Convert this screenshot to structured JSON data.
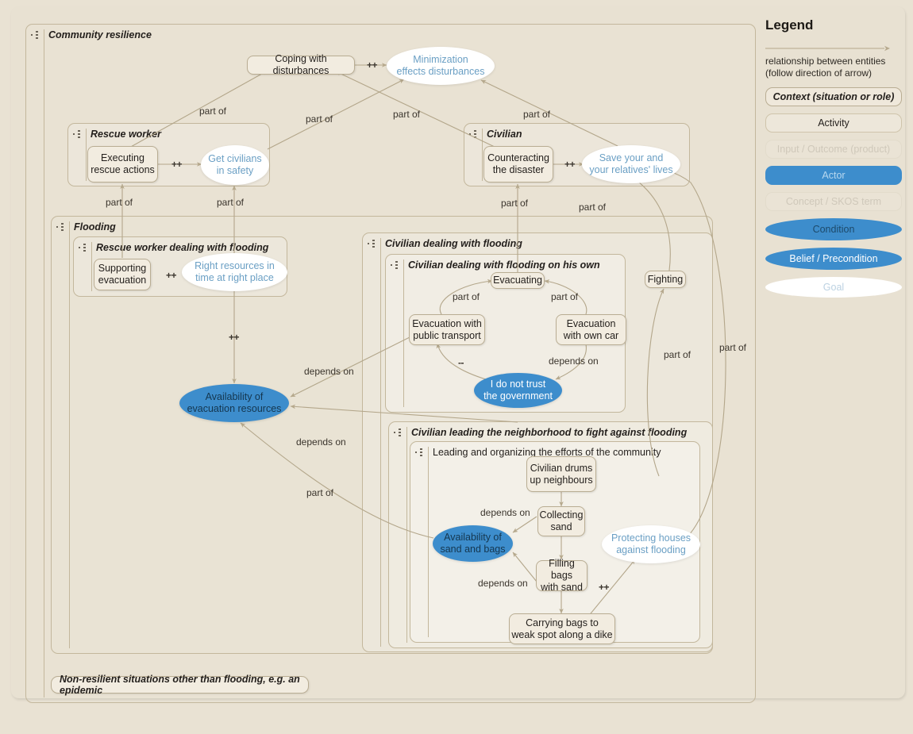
{
  "legend": {
    "title": "Legend",
    "arrow_note": "relationship between entities\n(follow direction of arrow)",
    "note_line1": "relationship between entities",
    "note_line2": "(follow direction of arrow)",
    "items": [
      {
        "key": "context",
        "label": "Context (situation or role)"
      },
      {
        "key": "activity",
        "label": "Activity"
      },
      {
        "key": "product",
        "label": "Input / Outcome (product)"
      },
      {
        "key": "actor",
        "label": "Actor"
      },
      {
        "key": "skos",
        "label": "Concept / SKOS term"
      },
      {
        "key": "condition",
        "label": "Condition"
      },
      {
        "key": "belief",
        "label": "Belief / Precondition"
      },
      {
        "key": "goal",
        "label": "Goal"
      }
    ],
    "colors": {
      "actor_blue": "#3d8dcc",
      "goal_white": "#ffffff",
      "context_border": "#b9ad93",
      "canvas": "#e8e1d2"
    }
  },
  "contexts": {
    "community_resilience": "Community resilience",
    "rescue_worker": "Rescue worker",
    "civilian": "Civilian",
    "flooding": "Flooding",
    "rescue_worker_flooding": "Rescue worker dealing with flooding",
    "civilian_flooding": "Civilian dealing with flooding",
    "civilian_own": "Civilian dealing with flooding on his own",
    "civilian_neighborhood": "Civilian leading the neighborhood to fight against flooding",
    "leading_organizing": "Leading and organizing the efforts of the community",
    "non_resilient": "Non-resilient situations other than flooding, e.g. an epidemic"
  },
  "nodes": {
    "coping": "Coping with disturbances",
    "minimization": "Minimization\neffects disturbances",
    "minimization_l1": "Minimization",
    "minimization_l2": "effects disturbances",
    "executing": "Executing\nrescue actions",
    "executing_l1": "Executing",
    "executing_l2": "rescue actions",
    "get_civilians": "Get civilians\nin safety",
    "get_civilians_l1": "Get civilians",
    "get_civilians_l2": "in safety",
    "counteracting": "Counteracting\nthe disaster",
    "counteracting_l1": "Counteracting",
    "counteracting_l2": "the disaster",
    "save_lives": "Save your and\nyour relatives' lives",
    "save_lives_l1": "Save your and",
    "save_lives_l2": "your relatives' lives",
    "supporting_evacuation": "Supporting\nevacuation",
    "supporting_evacuation_l1": "Supporting",
    "supporting_evacuation_l2": "evacuation",
    "right_resources": "Right resources in\ntime at right place",
    "right_resources_l1": "Right resources in",
    "right_resources_l2": "time at right place",
    "avail_evac": "Availability of\nevacuation resources",
    "avail_evac_l1": "Availability of",
    "avail_evac_l2": "evacuation resources",
    "evacuating": "Evacuating",
    "evac_public": "Evacuation with\npublic transport",
    "evac_public_l1": "Evacuation with",
    "evac_public_l2": "public transport",
    "evac_own_car": "Evacuation\nwith own car",
    "evac_own_car_l1": "Evacuation",
    "evac_own_car_l2": "with own car",
    "no_trust": "I do not trust\nthe government",
    "no_trust_l1": "I do not trust",
    "no_trust_l2": "the government",
    "fighting": "Fighting",
    "drums_up": "Civilian drums\nup neighbours",
    "drums_up_l1": "Civilian drums",
    "drums_up_l2": "up neighbours",
    "collecting_sand": "Collecting\nsand",
    "collecting_sand_l1": "Collecting",
    "collecting_sand_l2": "sand",
    "filling_bags": "Filling bags\nwith sand",
    "filling_bags_l1": "Filling bags",
    "filling_bags_l2": "with sand",
    "carrying_bags": "Carrying bags to\nweak spot along a dike",
    "carrying_bags_l1": "Carrying bags to",
    "carrying_bags_l2": "weak spot along a dike",
    "avail_sand": "Availability of\nsand and bags",
    "avail_sand_l1": "Availability of",
    "avail_sand_l2": "sand and bags",
    "protecting_houses": "Protecting houses\nagainst flooding",
    "protecting_houses_l1": "Protecting houses",
    "protecting_houses_l2": "against flooding"
  },
  "edge_labels": {
    "part_of": "part of",
    "depends_on": "depends on",
    "plus_plus": "++",
    "minus_minus": "--"
  },
  "edges": [
    {
      "from": "executing",
      "to": "get_civilians",
      "label": "++"
    },
    {
      "from": "coping",
      "to": "minimization",
      "label": "++"
    },
    {
      "from": "counteracting",
      "to": "save_lives",
      "label": "++"
    },
    {
      "from": "executing",
      "to": "coping",
      "label": "part of"
    },
    {
      "from": "get_civilians",
      "to": "minimization",
      "label": "part of"
    },
    {
      "from": "counteracting",
      "to": "coping",
      "label": "part of"
    },
    {
      "from": "save_lives",
      "to": "minimization",
      "label": "part of"
    },
    {
      "from": "supporting_evacuation",
      "to": "executing",
      "label": "part of"
    },
    {
      "from": "right_resources",
      "to": "get_civilians",
      "label": "part of"
    },
    {
      "from": "evacuating",
      "to": "counteracting",
      "label": "part of"
    },
    {
      "from": "fighting",
      "to": "save_lives",
      "label": "part of"
    },
    {
      "from": "supporting_evacuation",
      "to": "avail_evac",
      "label": "++"
    },
    {
      "from": "evac_public",
      "to": "evacuating",
      "label": "part of"
    },
    {
      "from": "evac_own_car",
      "to": "evacuating",
      "label": "part of"
    },
    {
      "from": "evac_own_car",
      "to": "no_trust",
      "label": "depends on"
    },
    {
      "from": "no_trust",
      "to": "evac_public",
      "label": "--"
    },
    {
      "from": "evac_public",
      "to": "avail_evac",
      "label": "depends on"
    },
    {
      "from": "drums_up",
      "to": "collecting_sand",
      "label": ""
    },
    {
      "from": "collecting_sand",
      "to": "avail_sand",
      "label": "depends on"
    },
    {
      "from": "collecting_sand",
      "to": "filling_bags",
      "label": ""
    },
    {
      "from": "filling_bags",
      "to": "avail_sand",
      "label": "depends on"
    },
    {
      "from": "filling_bags",
      "to": "carrying_bags",
      "label": ""
    },
    {
      "from": "carrying_bags",
      "to": "protecting_houses",
      "label": "++"
    },
    {
      "from": "leading_organizing",
      "to": "avail_evac",
      "label": "depends on"
    },
    {
      "from": "avail_sand",
      "to": "avail_evac",
      "label": "part of"
    },
    {
      "from": "protecting_houses",
      "to": "save_lives",
      "label": "part of"
    },
    {
      "from": "civilian_neighborhood",
      "to": "fighting",
      "label": "part of"
    }
  ]
}
